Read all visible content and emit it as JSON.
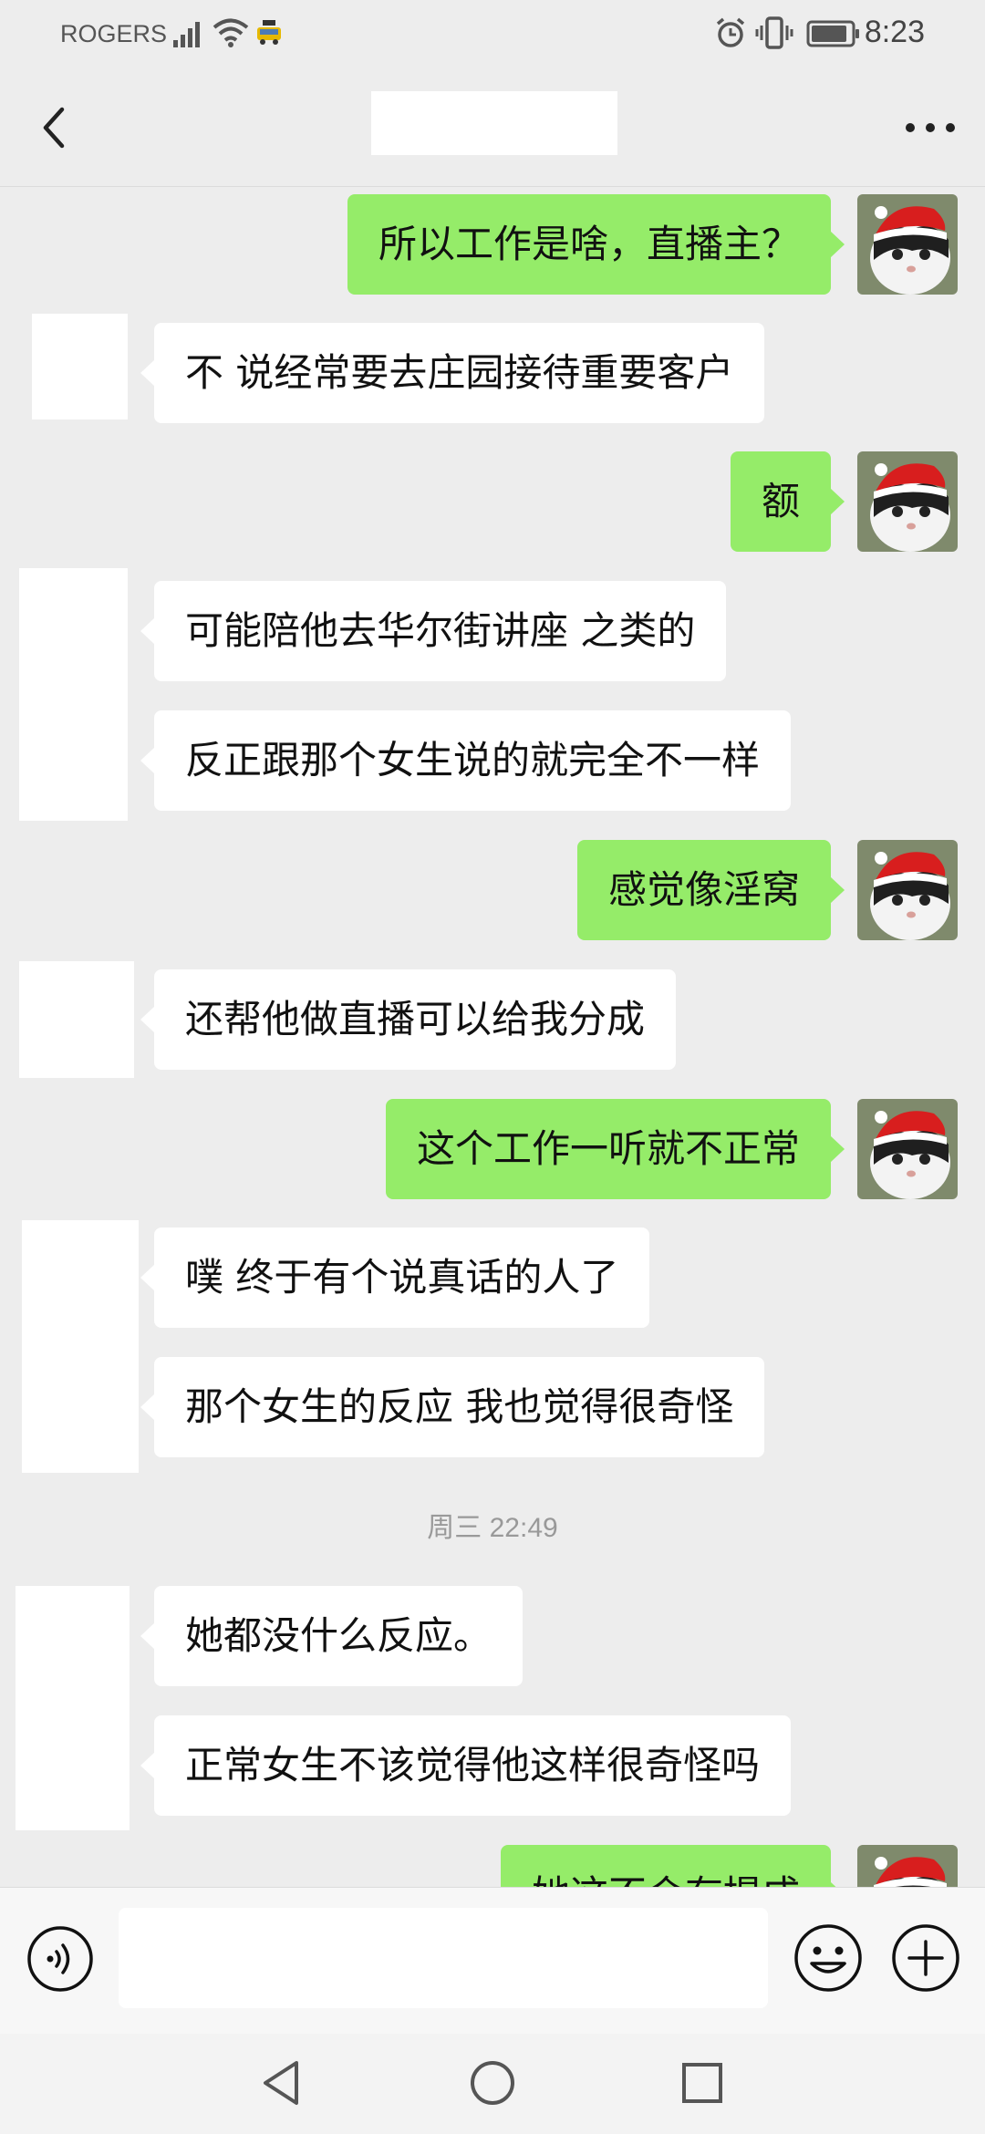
{
  "status_bar": {
    "carrier": "ROGERS",
    "time": "8:23"
  },
  "header": {
    "title": ""
  },
  "messages": [
    {
      "side": "out",
      "text": "所以工作是啥，直播主？"
    },
    {
      "side": "in",
      "text": "不 说经常要去庄园接待重要客户"
    },
    {
      "side": "out",
      "text": "额"
    },
    {
      "side": "in",
      "text": "可能陪他去华尔街讲座 之类的"
    },
    {
      "side": "in",
      "text": "反正跟那个女生说的就完全不一样"
    },
    {
      "side": "out",
      "text": "感觉像淫窝"
    },
    {
      "side": "in",
      "text": "还帮他做直播可以给我分成"
    },
    {
      "side": "out",
      "text": "这个工作一听就不正常"
    },
    {
      "side": "in",
      "text": "噗 终于有个说真话的人了"
    },
    {
      "side": "in",
      "text": "那个女生的反应 我也觉得很奇怪"
    },
    {
      "side": "in",
      "text": "她都没什么反应。"
    },
    {
      "side": "in",
      "text": "正常女生不该觉得他这样很奇怪吗"
    },
    {
      "side": "out",
      "text": "她这不会有提成"
    }
  ],
  "timestamp": "周三 22:49",
  "input": {
    "value": ""
  },
  "colors": {
    "background": "#ededed",
    "incoming_bubble": "#ffffff",
    "outgoing_bubble": "#95ec69",
    "timestamp_text": "#999999"
  },
  "icons": {
    "back": "chevron-left-icon",
    "more": "more-dots-icon",
    "voice": "voice-icon",
    "emoji": "emoji-icon",
    "add": "plus-icon",
    "nav_back": "nav-back-icon",
    "nav_home": "nav-home-icon",
    "nav_recent": "nav-recent-icon"
  }
}
